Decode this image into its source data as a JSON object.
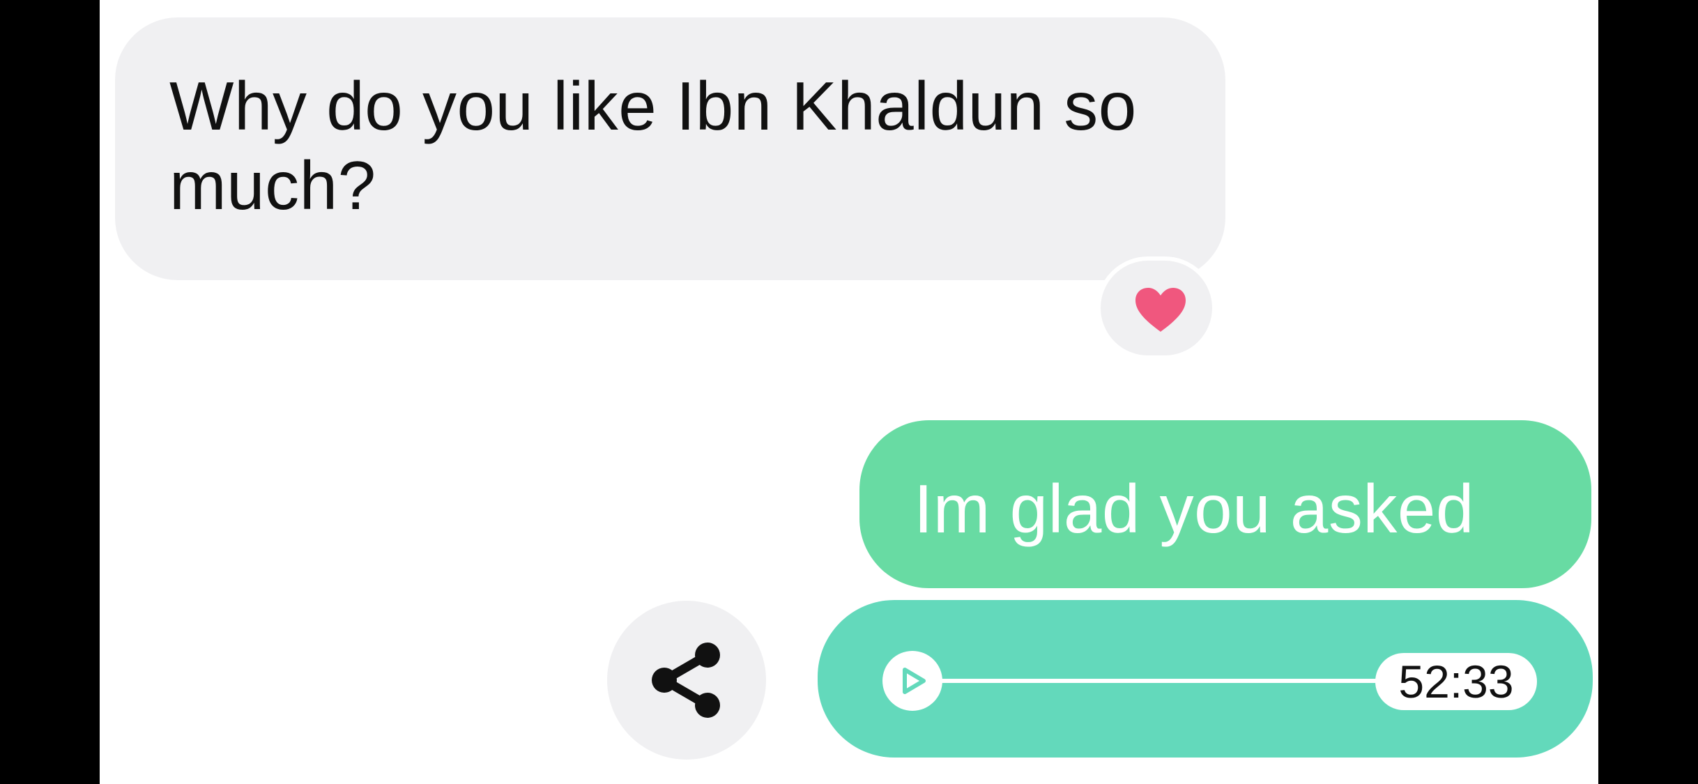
{
  "conversation": {
    "incoming": {
      "text": "Why do you like Ibn Khaldun so much?",
      "reaction": "heart-icon",
      "reaction_color": "#f0577e"
    },
    "outgoing": {
      "text": "Im glad you asked",
      "audio": {
        "duration": "52:33",
        "progress": 0,
        "play_icon": "play-icon"
      },
      "bubble_color": "#68dba3",
      "audio_bubble_color": "#63d9bb"
    },
    "share_icon": "share-icon"
  }
}
